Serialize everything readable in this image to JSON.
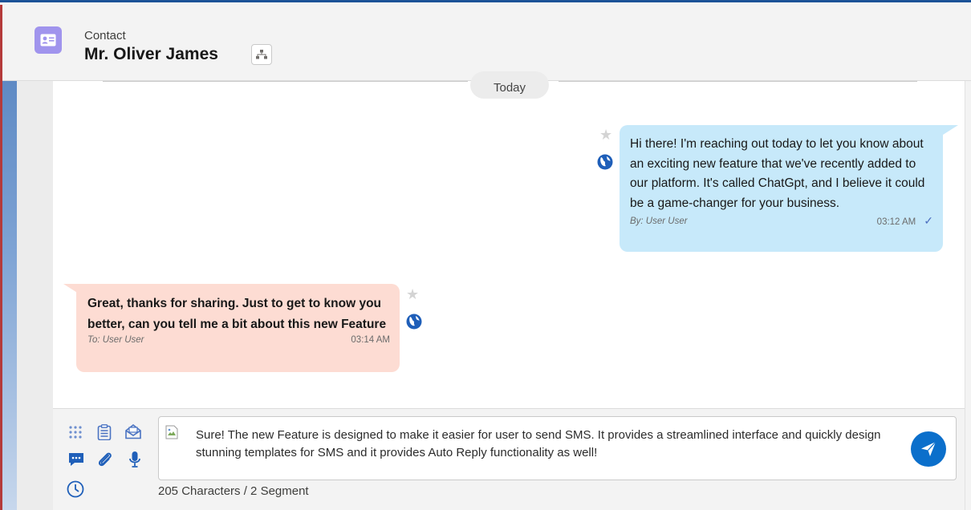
{
  "header": {
    "record_type": "Contact",
    "record_name": "Mr. Oliver James",
    "icon": "contact-card-icon",
    "hierarchy_icon": "hierarchy-icon"
  },
  "chat": {
    "date_divider": "Today",
    "messages": [
      {
        "direction": "outgoing",
        "text": "Hi there! I'm reaching out today to let you know about an exciting new feature that we've recently added to our platform. It's called ChatGpt, and I believe it could be a game-changer for your business.",
        "sender_label": "By: User User",
        "time": "03:12 AM",
        "status_icon": "check-icon",
        "bubble_color": "#c7e9fa"
      },
      {
        "direction": "incoming",
        "text": "Great, thanks for sharing. Just to get to know you better, can you tell me a bit about this new Feature",
        "sender_label": "To: User User",
        "time": "03:14 AM",
        "bubble_color": "#fddcd3"
      }
    ]
  },
  "composer": {
    "tools": [
      "apps-grid-icon",
      "clipboard-icon",
      "open-envelope-icon",
      "chat-bubble-icon",
      "paperclip-icon",
      "microphone-icon",
      "clock-icon"
    ],
    "message": "Sure! The new Feature is designed to make it easier for user to send SMS. It provides a streamlined interface and quickly design stunning templates for SMS and it provides Auto Reply functionality as well!",
    "counter": "205 Characters / 2 Segment",
    "send_icon": "send-icon",
    "accent": "#0b6fcb"
  }
}
